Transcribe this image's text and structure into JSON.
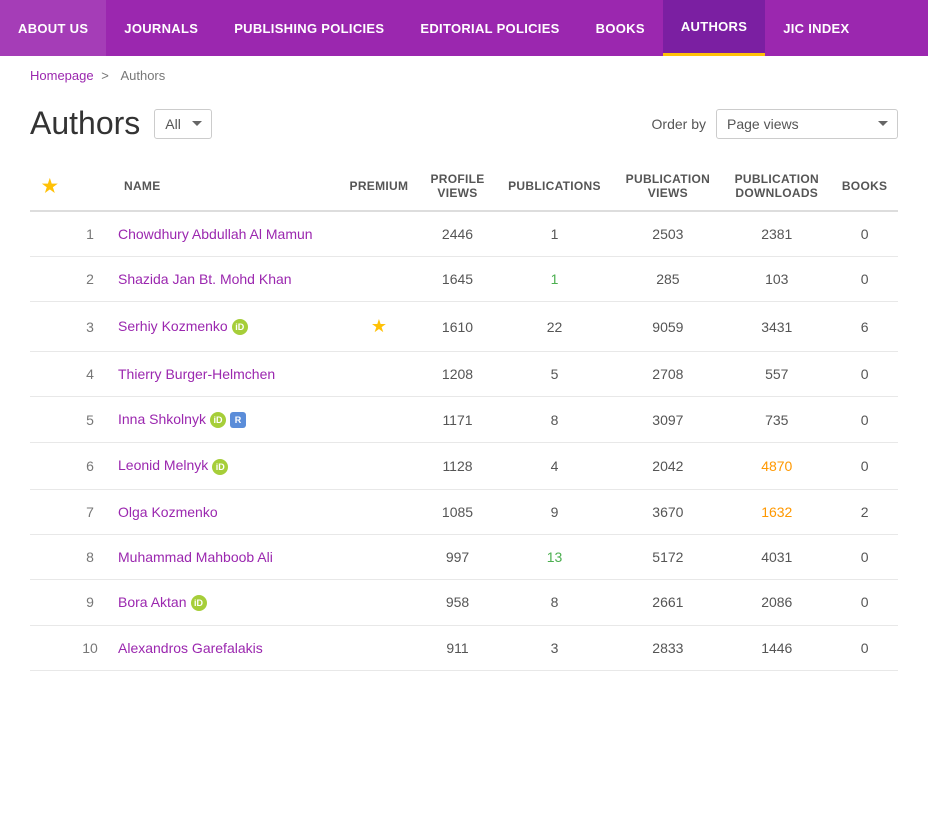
{
  "nav": {
    "items": [
      {
        "label": "ABOUT US",
        "href": "#",
        "active": false
      },
      {
        "label": "JOURNALS",
        "href": "#",
        "active": false
      },
      {
        "label": "PUBLISHING POLICIES",
        "href": "#",
        "active": false
      },
      {
        "label": "EDITORIAL POLICIES",
        "href": "#",
        "active": false
      },
      {
        "label": "BOOKS",
        "href": "#",
        "active": false
      },
      {
        "label": "AUTHORS",
        "href": "#",
        "active": true
      },
      {
        "label": "JIC INDEX",
        "href": "#",
        "active": false
      }
    ]
  },
  "breadcrumb": {
    "home": "Homepage",
    "separator": ">",
    "current": "Authors"
  },
  "page": {
    "title": "Authors",
    "filter_label": "All",
    "order_label": "Order by",
    "order_value": "Page views"
  },
  "table": {
    "columns": [
      {
        "key": "star",
        "label": ""
      },
      {
        "key": "num",
        "label": ""
      },
      {
        "key": "name",
        "label": "NAME"
      },
      {
        "key": "premium",
        "label": "PREMIUM"
      },
      {
        "key": "profile_views",
        "label": "PROFILE VIEWS"
      },
      {
        "key": "publications",
        "label": "PUBLICATIONS"
      },
      {
        "key": "publication_views",
        "label": "PUBLICATION VIEWS"
      },
      {
        "key": "publication_downloads",
        "label": "PUBLICATION DOWNLOADS"
      },
      {
        "key": "books",
        "label": "BOOKS"
      }
    ],
    "rows": [
      {
        "num": 1,
        "name": "Chowdhury Abdullah Al Mamun",
        "premium": false,
        "profile_views": "2446",
        "publications": "1",
        "publication_views": "2503",
        "publication_downloads": "2381",
        "books": "0",
        "orcid": false,
        "researchgate": false,
        "pub_highlight": false,
        "dl_highlight": false
      },
      {
        "num": 2,
        "name": "Shazida Jan Bt. Mohd Khan",
        "premium": false,
        "profile_views": "1645",
        "publications": "1",
        "publication_views": "285",
        "publication_downloads": "103",
        "books": "0",
        "orcid": false,
        "researchgate": false,
        "pub_highlight": true,
        "dl_highlight": false
      },
      {
        "num": 3,
        "name": "Serhiy Kozmenko",
        "premium": true,
        "profile_views": "1610",
        "publications": "22",
        "publication_views": "9059",
        "publication_downloads": "3431",
        "books": "6",
        "orcid": true,
        "researchgate": false,
        "pub_highlight": false,
        "dl_highlight": false
      },
      {
        "num": 4,
        "name": "Thierry Burger-Helmchen",
        "premium": false,
        "profile_views": "1208",
        "publications": "5",
        "publication_views": "2708",
        "publication_downloads": "557",
        "books": "0",
        "orcid": false,
        "researchgate": false,
        "pub_highlight": false,
        "dl_highlight": false
      },
      {
        "num": 5,
        "name": "Inna Shkolnyk",
        "premium": false,
        "profile_views": "1171",
        "publications": "8",
        "publication_views": "3097",
        "publication_downloads": "735",
        "books": "0",
        "orcid": true,
        "researchgate": true,
        "pub_highlight": false,
        "dl_highlight": false
      },
      {
        "num": 6,
        "name": "Leonid Melnyk",
        "premium": false,
        "profile_views": "1128",
        "publications": "4",
        "publication_views": "2042",
        "publication_downloads": "4870",
        "books": "0",
        "orcid": true,
        "researchgate": false,
        "pub_highlight": false,
        "dl_highlight": true
      },
      {
        "num": 7,
        "name": "Olga Kozmenko",
        "premium": false,
        "profile_views": "1085",
        "publications": "9",
        "publication_views": "3670",
        "publication_downloads": "1632",
        "books": "2",
        "orcid": false,
        "researchgate": false,
        "pub_highlight": false,
        "dl_highlight": true
      },
      {
        "num": 8,
        "name": "Muhammad Mahboob Ali",
        "premium": false,
        "profile_views": "997",
        "publications": "13",
        "publication_views": "5172",
        "publication_downloads": "4031",
        "books": "0",
        "orcid": false,
        "researchgate": false,
        "pub_highlight": true,
        "dl_highlight": false
      },
      {
        "num": 9,
        "name": "Bora Aktan",
        "premium": false,
        "profile_views": "958",
        "publications": "8",
        "publication_views": "2661",
        "publication_downloads": "2086",
        "books": "0",
        "orcid": true,
        "researchgate": false,
        "pub_highlight": false,
        "dl_highlight": false
      },
      {
        "num": 10,
        "name": "Alexandros Garefalakis",
        "premium": false,
        "profile_views": "911",
        "publications": "3",
        "publication_views": "2833",
        "publication_downloads": "1446",
        "books": "0",
        "orcid": false,
        "researchgate": false,
        "pub_highlight": false,
        "dl_highlight": false
      }
    ]
  }
}
